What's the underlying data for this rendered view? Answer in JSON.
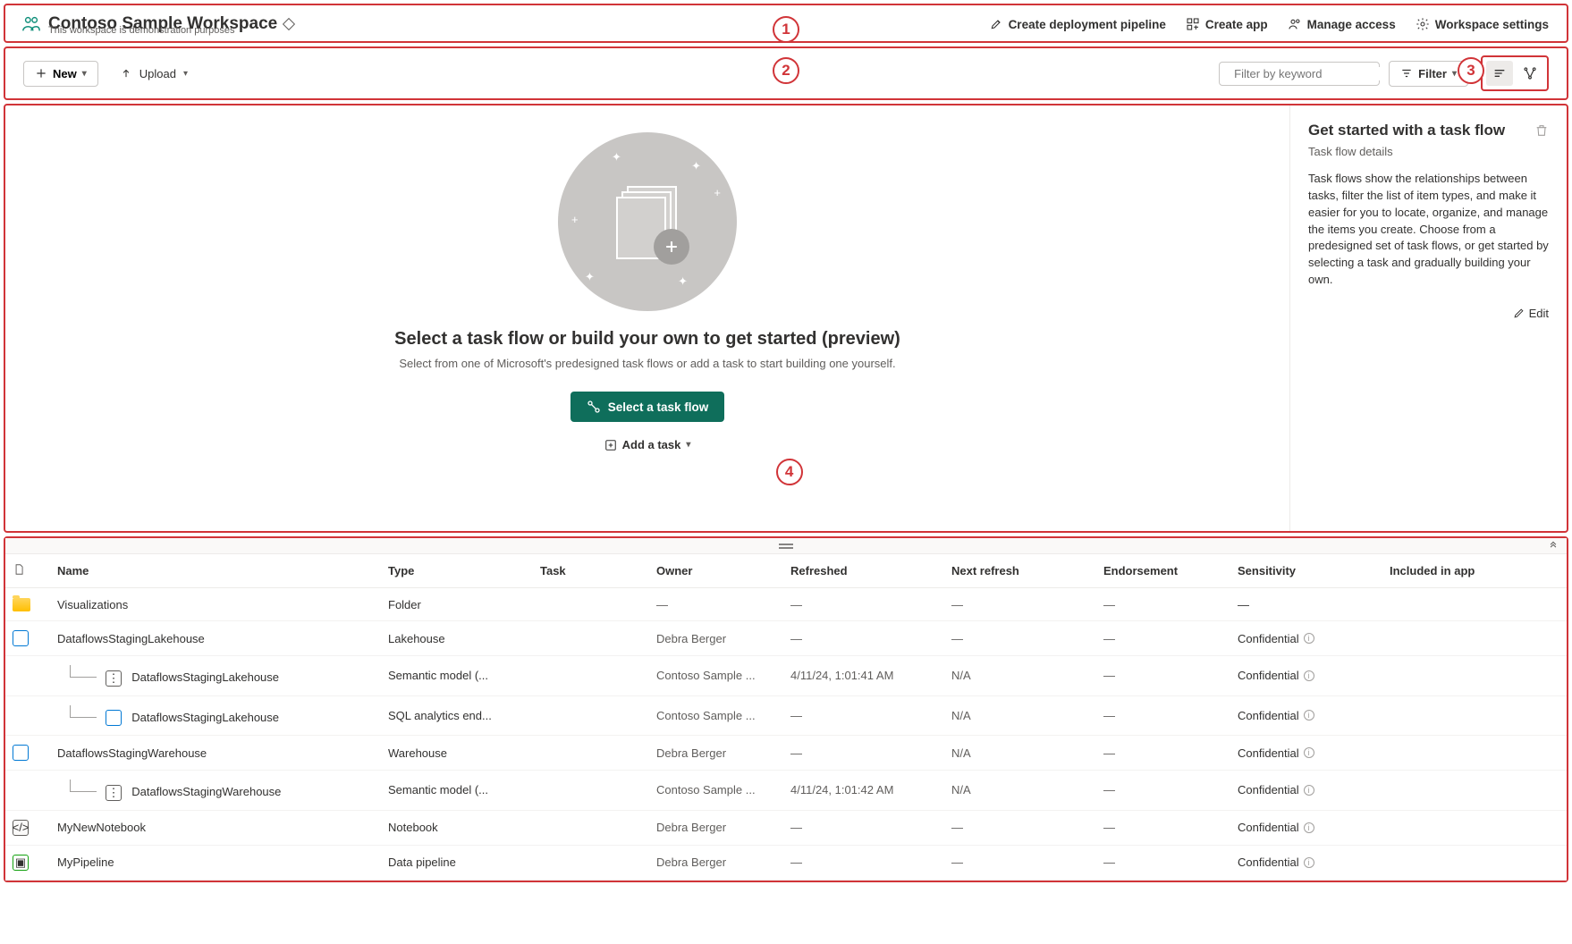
{
  "header": {
    "title": "Contoso Sample Workspace",
    "subtitle": "This workspace is demonstration purposes",
    "actions": {
      "pipeline": "Create deployment pipeline",
      "app": "Create app",
      "access": "Manage access",
      "settings": "Workspace settings"
    }
  },
  "toolbar": {
    "new": "New",
    "upload": "Upload",
    "filter_placeholder": "Filter by keyword",
    "filter": "Filter"
  },
  "taskflow": {
    "heading": "Select a task flow or build your own to get started (preview)",
    "sub": "Select from one of Microsoft's predesigned task flows or add a task to start building one yourself.",
    "select_btn": "Select a task flow",
    "add_task": "Add a task"
  },
  "sidepanel": {
    "title": "Get started with a task flow",
    "subtitle": "Task flow details",
    "body": "Task flows show the relationships between tasks, filter the list of item types, and make it easier for you to locate, organize, and manage the items you create. Choose from a predesigned set of task flows, or get started by selecting a task and gradually building your own.",
    "edit": "Edit"
  },
  "table": {
    "cols": {
      "name": "Name",
      "type": "Type",
      "task": "Task",
      "owner": "Owner",
      "refreshed": "Refreshed",
      "next": "Next refresh",
      "endorse": "Endorsement",
      "sens": "Sensitivity",
      "incl": "Included in app"
    },
    "rows": [
      {
        "indent": 0,
        "icon": "folder",
        "name": "Visualizations",
        "type": "Folder",
        "task": "",
        "owner": "—",
        "refreshed": "—",
        "next": "—",
        "endorse": "—",
        "sens": "—"
      },
      {
        "indent": 0,
        "icon": "lake",
        "name": "DataflowsStagingLakehouse",
        "type": "Lakehouse",
        "task": "",
        "owner": "Debra Berger",
        "refreshed": "—",
        "next": "—",
        "endorse": "—",
        "sens": "Confidential"
      },
      {
        "indent": 1,
        "icon": "model",
        "name": "DataflowsStagingLakehouse",
        "type": "Semantic model (...",
        "task": "",
        "owner": "Contoso Sample ...",
        "refreshed": "4/11/24, 1:01:41 AM",
        "next": "N/A",
        "endorse": "—",
        "sens": "Confidential"
      },
      {
        "indent": 1,
        "icon": "lake",
        "name": "DataflowsStagingLakehouse",
        "type": "SQL analytics end...",
        "task": "",
        "owner": "Contoso Sample ...",
        "refreshed": "—",
        "next": "N/A",
        "endorse": "—",
        "sens": "Confidential"
      },
      {
        "indent": 0,
        "icon": "lake",
        "name": "DataflowsStagingWarehouse",
        "type": "Warehouse",
        "task": "",
        "owner": "Debra Berger",
        "refreshed": "—",
        "next": "N/A",
        "endorse": "—",
        "sens": "Confidential"
      },
      {
        "indent": 1,
        "icon": "model",
        "name": "DataflowsStagingWarehouse",
        "type": "Semantic model (...",
        "task": "",
        "owner": "Contoso Sample ...",
        "refreshed": "4/11/24, 1:01:42 AM",
        "next": "N/A",
        "endorse": "—",
        "sens": "Confidential"
      },
      {
        "indent": 0,
        "icon": "nb",
        "name": "MyNewNotebook",
        "type": "Notebook",
        "task": "",
        "owner": "Debra Berger",
        "refreshed": "—",
        "next": "—",
        "endorse": "—",
        "sens": "Confidential"
      },
      {
        "indent": 0,
        "icon": "pipe",
        "name": "MyPipeline",
        "type": "Data pipeline",
        "task": "",
        "owner": "Debra Berger",
        "refreshed": "—",
        "next": "—",
        "endorse": "—",
        "sens": "Confidential"
      }
    ]
  },
  "callouts": {
    "c1": "1",
    "c2": "2",
    "c3": "3",
    "c4": "4"
  }
}
